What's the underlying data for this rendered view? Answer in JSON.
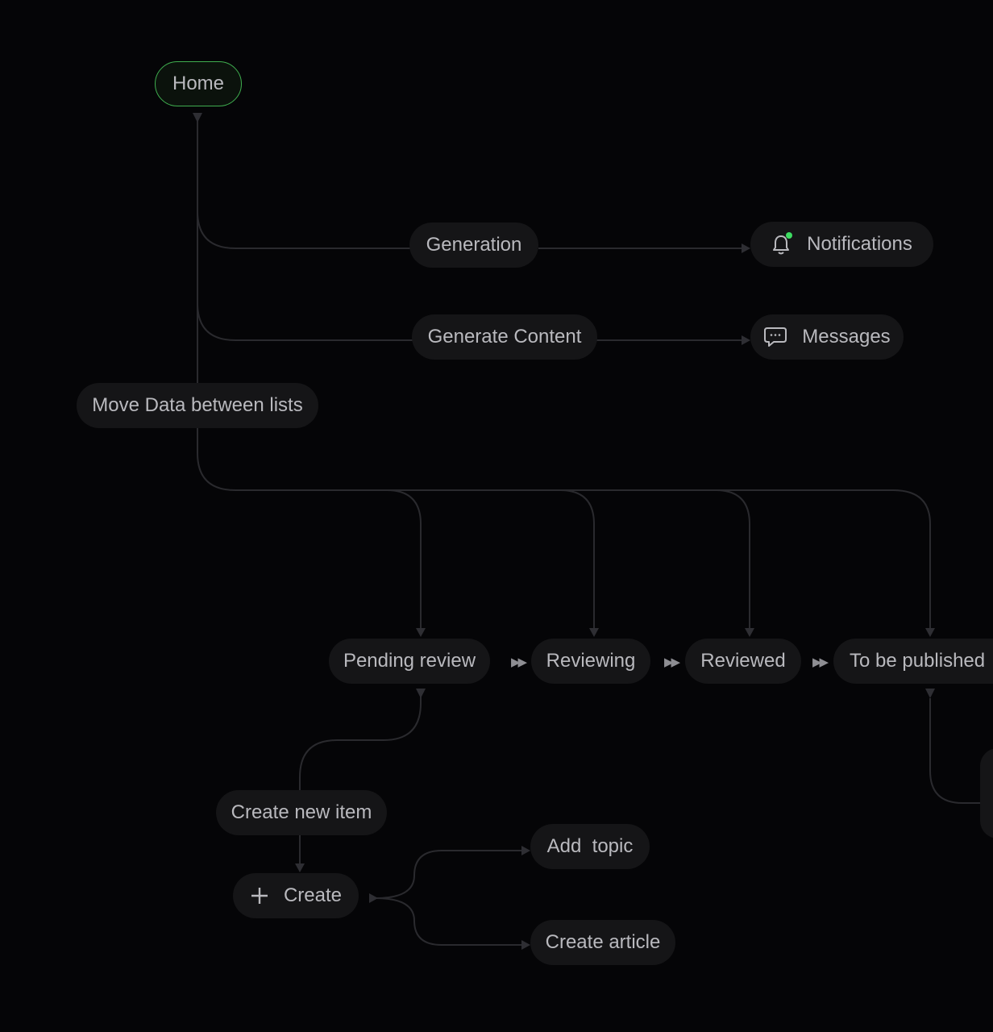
{
  "nodes": {
    "home": "Home",
    "generation": "Generation",
    "notifications": "Notifications",
    "generate_content": "Generate Content",
    "messages": "Messages",
    "move_data": "Move Data between lists",
    "pending_review": "Pending review",
    "reviewing": "Reviewing",
    "reviewed": "Reviewed",
    "to_be_published": "To be published",
    "create_new_item": "Create new item",
    "create": "Create",
    "add_topic": "Add  topic",
    "create_article": "Create article"
  },
  "icons": {
    "notifications": "bell-icon",
    "messages": "chat-bubble-icon",
    "create": "plus-icon",
    "step_separator": "double-arrow-icon"
  },
  "colors": {
    "background": "#050507",
    "node_fill": "#151517",
    "node_text": "#b9b9be",
    "home_border": "#3fae4f",
    "status_dot": "#3ddc61",
    "edge": "#2a2a2e"
  }
}
